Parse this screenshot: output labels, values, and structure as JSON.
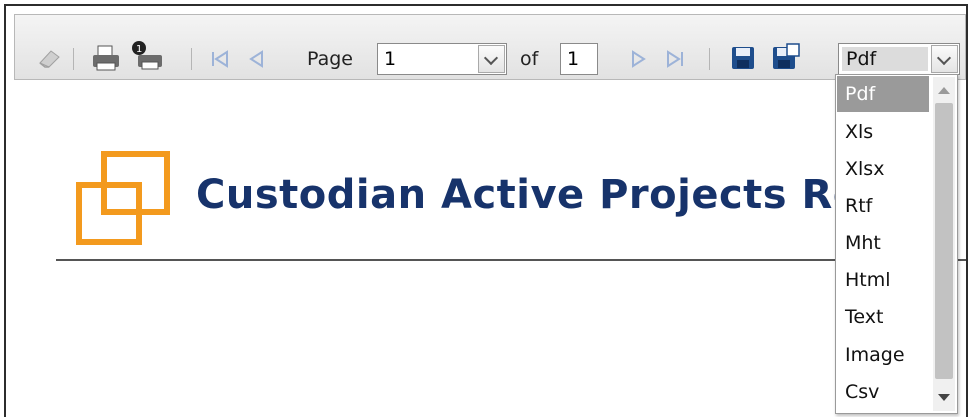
{
  "toolbar": {
    "page_label": "Page",
    "page_value": "1",
    "of_label": "of",
    "total_pages": "1",
    "format_value": "Pdf"
  },
  "icons": {
    "highlight": "eraser-icon",
    "print": "print-icon",
    "print_current": "print-page-icon",
    "first": "first-page-icon",
    "prev": "previous-page-icon",
    "next": "next-page-icon",
    "last": "last-page-icon",
    "save": "save-icon",
    "save_window": "save-new-window-icon"
  },
  "report": {
    "title": "Custodian Active Projects Re"
  },
  "format_options": [
    "Pdf",
    "Xls",
    "Xlsx",
    "Rtf",
    "Mht",
    "Html",
    "Text",
    "Image",
    "Csv"
  ],
  "colors": {
    "title": "#17336b",
    "logo": "#f39a1e",
    "selected_option": "#9a9a9a"
  }
}
